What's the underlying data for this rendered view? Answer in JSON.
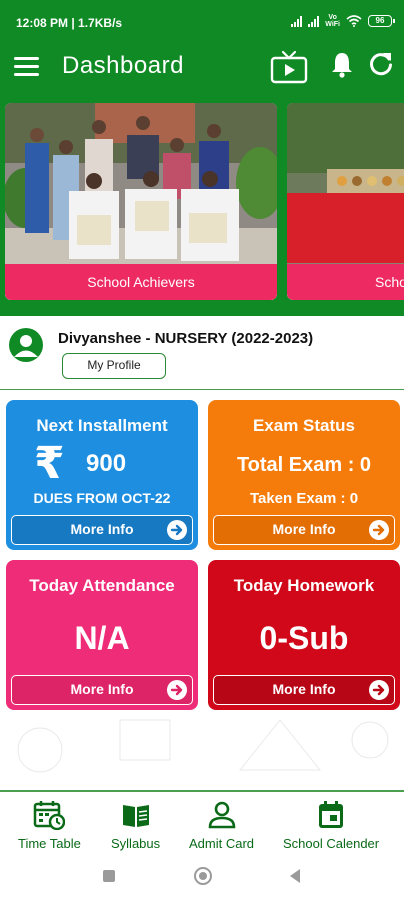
{
  "status_bar": {
    "time": "12:08 PM | 1.7KB/s",
    "vowifi_top": "Vo",
    "vowifi_bottom": "WiFi",
    "battery": "96"
  },
  "app_bar": {
    "title": "Dashboard",
    "icons": [
      "menu-icon",
      "tv-icon",
      "bell-icon",
      "refresh-icon"
    ]
  },
  "banner": {
    "slides": [
      {
        "caption": "School Achievers"
      },
      {
        "caption": "School"
      }
    ]
  },
  "profile": {
    "student": "Divyanshee - NURSERY (2022-2023)",
    "button": "My Profile"
  },
  "cards": {
    "installment": {
      "title": "Next Installment",
      "currency": "₹",
      "amount": "900",
      "dues": "DUES FROM OCT-22",
      "more": "More Info",
      "color": "#1e8fe0"
    },
    "exam": {
      "title": "Exam Status",
      "total": "Total Exam : 0",
      "taken": "Taken Exam : 0",
      "more": "More Info",
      "color": "#f57c0b"
    },
    "attendance": {
      "title": "Today Attendance",
      "value": "N/A",
      "more": "More Info",
      "color": "#ee2c78"
    },
    "homework": {
      "title": "Today Homework",
      "value": "0-Sub",
      "more": "More Info",
      "color": "#d0081a"
    }
  },
  "bottom_nav": [
    {
      "label": "Time Table",
      "icon": "timetable-icon"
    },
    {
      "label": "Syllabus",
      "icon": "book-icon"
    },
    {
      "label": "Admit Card",
      "icon": "admit-card-icon"
    },
    {
      "label": "School Calender",
      "icon": "calendar-icon"
    }
  ],
  "colors": {
    "primary": "#0f8a24",
    "banner_caption": "#ee2a63"
  }
}
